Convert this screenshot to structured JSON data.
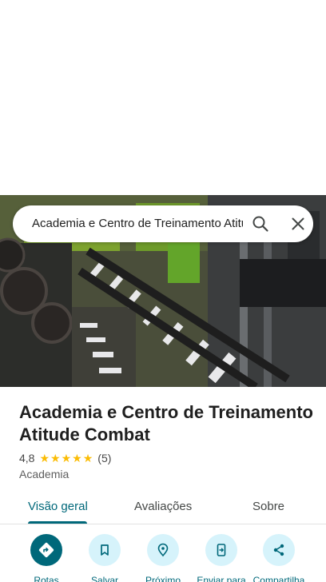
{
  "search": {
    "query": "Academia e Centro de Treinamento Atitude Combat"
  },
  "place": {
    "name": "Academia e Centro de Treinamento Atitude Combat",
    "rating": "4,8",
    "stars": 5,
    "reviews_count": "(5)",
    "category": "Academia"
  },
  "tabs": [
    {
      "label": "Visão geral",
      "active": true
    },
    {
      "label": "Avaliações",
      "active": false
    },
    {
      "label": "Sobre",
      "active": false
    }
  ],
  "actions": [
    {
      "label": "Rotas",
      "icon": "directions-icon"
    },
    {
      "label": "Salvar",
      "icon": "bookmark-icon"
    },
    {
      "label": "Próximo",
      "icon": "nearby-icon"
    },
    {
      "label": "Enviar para",
      "icon": "send-to-phone-icon"
    },
    {
      "label": "Compartilha",
      "icon": "share-icon"
    }
  ],
  "colors": {
    "accent": "#00687a",
    "action_bg": "#d6f3fb",
    "star": "#fbbc04"
  }
}
